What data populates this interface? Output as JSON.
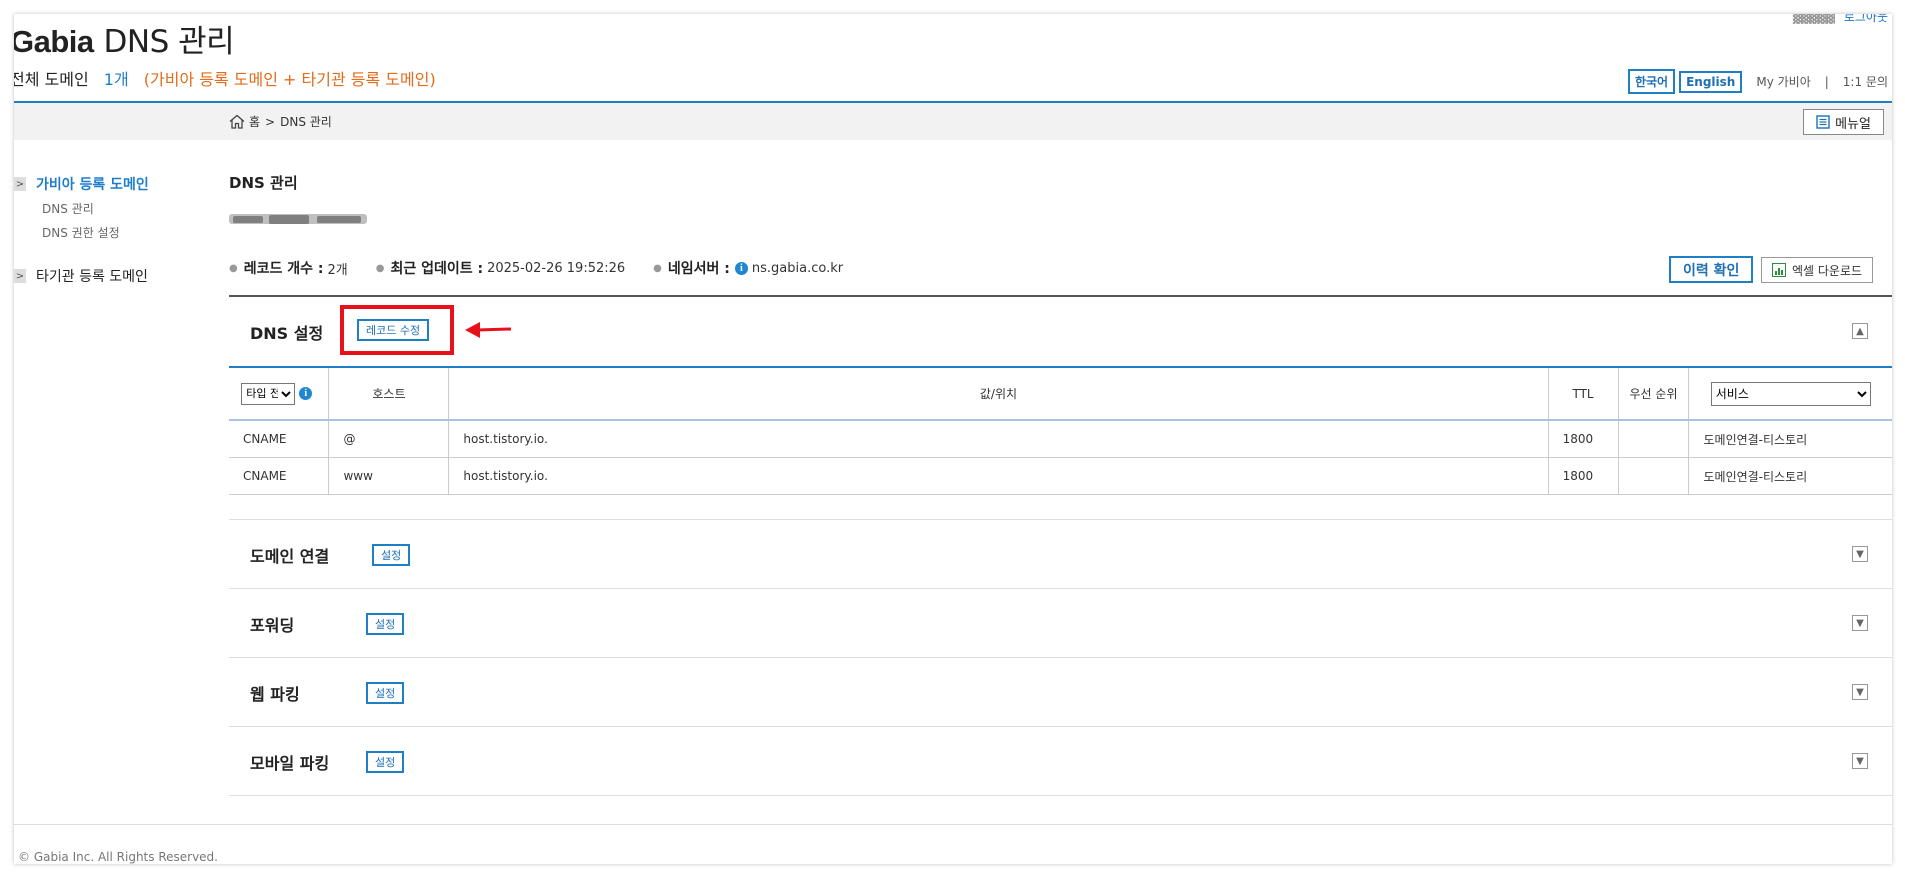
{
  "header": {
    "logo_brand": "Gabia",
    "logo_suffix": "DNS 관리",
    "logout_label": "로그아웃",
    "summary_label": "전체 도메인",
    "summary_count": "1개",
    "summary_detail": "(가비아 등록 도메인 + 타기관 등록 도메인)",
    "lang_ko": "한국어",
    "lang_en": "English",
    "my_gabia": "My 가비아",
    "divider": "|",
    "inquiry": "1:1 문의"
  },
  "breadcrumb": {
    "home": "홈",
    "sep": ">",
    "current": "DNS 관리"
  },
  "manual_button": "메뉴얼",
  "sidebar": {
    "items": [
      {
        "label": "가비아 등록 도메인",
        "active": true,
        "subitems": [
          "DNS 관리",
          "DNS 권한 설정"
        ]
      },
      {
        "label": "타기관 등록 도메인",
        "active": false
      }
    ]
  },
  "main": {
    "title": "DNS 관리",
    "stats": {
      "record_count_label": "레코드 개수 :",
      "record_count_value": "2개",
      "last_update_label": "최근 업데이트 :",
      "last_update_value": "2025-02-26 19:52:26",
      "nameserver_label": "네임서버 :",
      "nameserver_value": "ns.gabia.co.kr"
    },
    "history_button": "이력 확인",
    "excel_button": "엑셀 다운로드"
  },
  "dns_settings": {
    "title": "DNS 설정",
    "edit_button": "레코드 수정",
    "table": {
      "type_select": "타입 전",
      "columns": [
        "호스트",
        "값/위치",
        "TTL",
        "우선 순위"
      ],
      "service_select": "서비스",
      "rows": [
        {
          "type": "CNAME",
          "host": "@",
          "value": "host.tistory.io.",
          "ttl": "1800",
          "priority": "",
          "service": "도메인연결-티스토리"
        },
        {
          "type": "CNAME",
          "host": "www",
          "value": "host.tistory.io.",
          "ttl": "1800",
          "priority": "",
          "service": "도메인연결-티스토리"
        }
      ]
    }
  },
  "sections": [
    {
      "title": "도메인 연결",
      "button": "설정"
    },
    {
      "title": "포워딩",
      "button": "설정"
    },
    {
      "title": "웹 파킹",
      "button": "설정"
    },
    {
      "title": "모바일 파킹",
      "button": "설정"
    }
  ],
  "footer": {
    "copyright": "© Gabia Inc. All Rights Reserved."
  },
  "colors": {
    "accent": "#1e7fc5",
    "highlight": "#e8101a",
    "orange": "#e36b1a"
  }
}
